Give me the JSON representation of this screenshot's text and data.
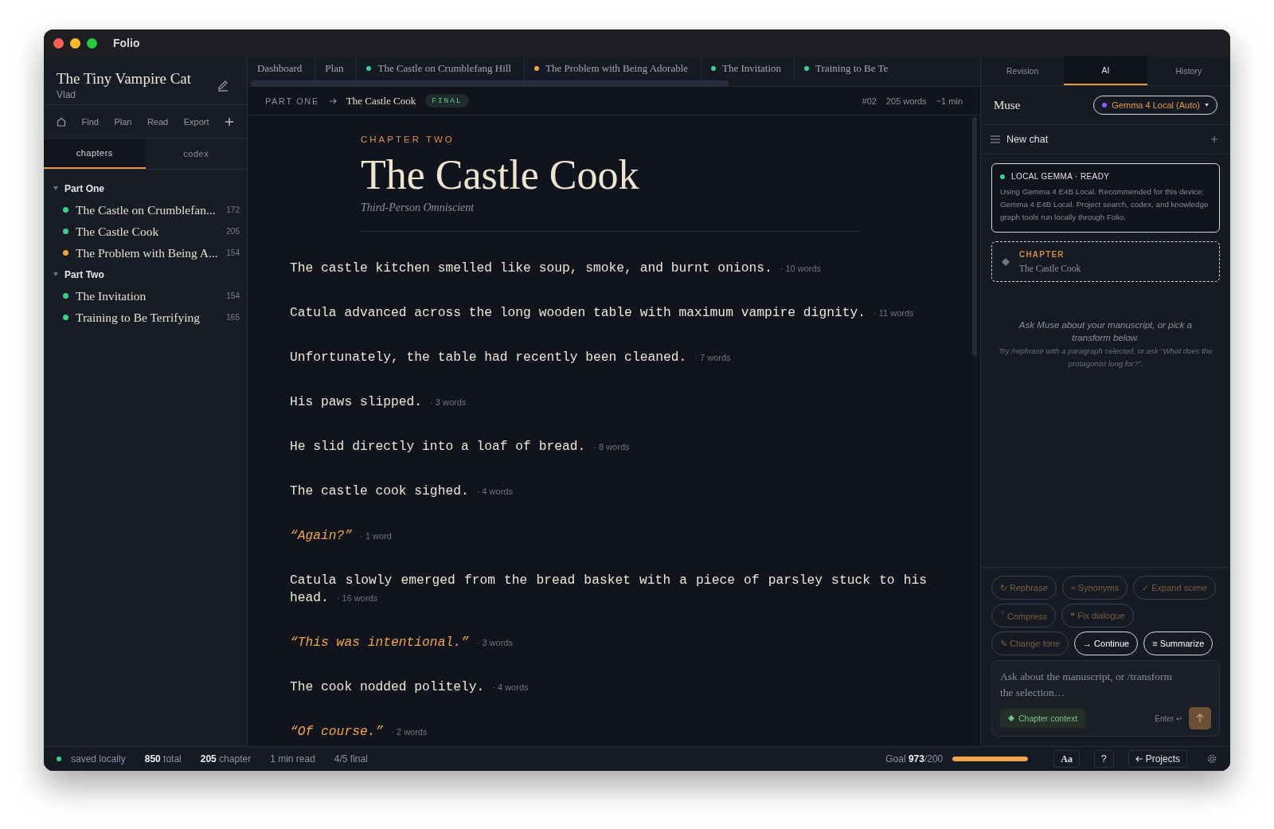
{
  "window": {
    "title": "Folio"
  },
  "sidebar": {
    "book_title": "The Tiny Vampire Cat",
    "author": "Vlad",
    "nav": [
      "Find",
      "Plan",
      "Read",
      "Export"
    ],
    "tabs": [
      {
        "label": "chapters",
        "selected": true
      },
      {
        "label": "codex",
        "selected": false
      }
    ],
    "parts": [
      {
        "title": "Part One",
        "expanded": true,
        "children": [
          {
            "title": "The Castle on Crumblefan...",
            "count": "172",
            "color": "#3ecf8e"
          },
          {
            "title": "The Castle Cook",
            "count": "205",
            "color": "#3ecf8e"
          },
          {
            "title": "The Problem with Being A...",
            "count": "154",
            "color": "#f0a53c"
          }
        ]
      },
      {
        "title": "Part Two",
        "expanded": true,
        "children": [
          {
            "title": "The Invitation",
            "count": "154",
            "color": "#3ecf8e"
          },
          {
            "title": "Training to Be Terrifying",
            "count": "165",
            "color": "#3ecf8e"
          }
        ]
      }
    ]
  },
  "editor_tabs": [
    {
      "label": "Dashboard"
    },
    {
      "label": "Plan"
    },
    {
      "label": "The Castle on Crumblefang Hill",
      "color": "#3ecf8e"
    },
    {
      "label": "The Problem with Being Adorable",
      "color": "#f0a53c"
    },
    {
      "label": "The Invitation",
      "color": "#3ecf8e"
    },
    {
      "label": "Training to Be Te",
      "color": "#3ecf8e"
    }
  ],
  "breadcrumb": {
    "part": "PART ONE",
    "chapter": "The Castle Cook",
    "badge": "FINAL",
    "number": "#02",
    "words": "205 words",
    "time": "~1 min"
  },
  "chapter": {
    "label": "CHAPTER TWO",
    "title": "The Castle Cook",
    "pov": "Third-Person Omniscient",
    "paragraphs": [
      {
        "kind": "narration",
        "text": "The castle kitchen smelled like soup, smoke, and burnt onions.",
        "count": "· 10 words"
      },
      {
        "kind": "narration",
        "text": "Catula advanced across the long wooden table with maximum vampire dignity.",
        "count": "· 11 words"
      },
      {
        "kind": "narration",
        "text": "Unfortunately, the table had recently been cleaned.",
        "count": "· 7 words"
      },
      {
        "kind": "narration",
        "text": "His paws slipped.",
        "count": "· 3 words"
      },
      {
        "kind": "narration",
        "text": "He slid directly into a loaf of bread.",
        "count": "· 8 words"
      },
      {
        "kind": "narration",
        "text": "The castle cook sighed.",
        "count": "· 4 words"
      },
      {
        "kind": "dialogue",
        "text": "“Again?”",
        "count": "· 1 word"
      },
      {
        "kind": "narration",
        "text": "Catula slowly emerged from the bread basket with a piece of parsley stuck to his head.",
        "count": "· 16 words"
      },
      {
        "kind": "dialogue",
        "text": "“This was intentional.”",
        "count": "· 3 words"
      },
      {
        "kind": "narration",
        "text": "The cook nodded politely.",
        "count": "· 4 words"
      },
      {
        "kind": "dialogue",
        "text": "“Of course.”",
        "count": "· 2 words"
      }
    ]
  },
  "assistant": {
    "tabs": [
      {
        "label": "Revision",
        "selected": false
      },
      {
        "label": "AI",
        "selected": true
      },
      {
        "label": "History",
        "selected": false
      }
    ],
    "name": "Muse",
    "model": {
      "label": "Gemma 4 Local (Auto)",
      "color": "#8b5cf6"
    },
    "chat_title": "New chat",
    "status": {
      "title": "LOCAL GEMMA · READY",
      "color": "#3ecf8e",
      "text": "Using Gemma 4 E4B Local. Recommended for this device: Gemma 4 E4B Local. Project search, codex, and knowledge graph tools run locally through Folio."
    },
    "context": {
      "label": "CHAPTER",
      "value": "The Castle Cook"
    },
    "hint": "Ask Muse about your manuscript, or pick a transform below.",
    "hint_detail": "Try /rephrase with a paragraph selected, or ask “What does the protagonist long for?”.",
    "transform_rows": [
      [
        {
          "glyph": "↻",
          "label": "Rephrase",
          "disabled": true
        },
        {
          "glyph": "≈",
          "label": "Synonyms",
          "disabled": true
        },
        {
          "glyph": "✓",
          "label": "Expand scene",
          "disabled": true
        }
      ],
      [
        {
          "glyph": "ⸯ",
          "label": "Compress",
          "disabled": true
        },
        {
          "glyph": "❝",
          "label": "Fix dialogue",
          "disabled": true
        }
      ],
      [
        {
          "glyph": "✎",
          "label": "Change tone",
          "disabled": true
        },
        {
          "glyph": "→",
          "label": "Continue",
          "disabled": false
        },
        {
          "glyph": "≡",
          "label": "Summarize",
          "disabled": false
        }
      ]
    ],
    "input": {
      "placeholder": "Ask about the manuscript, or /transform the selection…",
      "context_chip": "Chapter context",
      "send_hint": "Enter ↵"
    }
  },
  "status_bar": {
    "saved": {
      "label": "saved locally",
      "color": "#3ecf8e"
    },
    "stats": [
      "**850** total",
      "**205** chapter",
      "1 min read",
      "4/5 final"
    ],
    "goal": "Goal **973**/200",
    "level": 1,
    "font_button": "Aa",
    "help_button": "?",
    "projects_button": "Projects"
  }
}
